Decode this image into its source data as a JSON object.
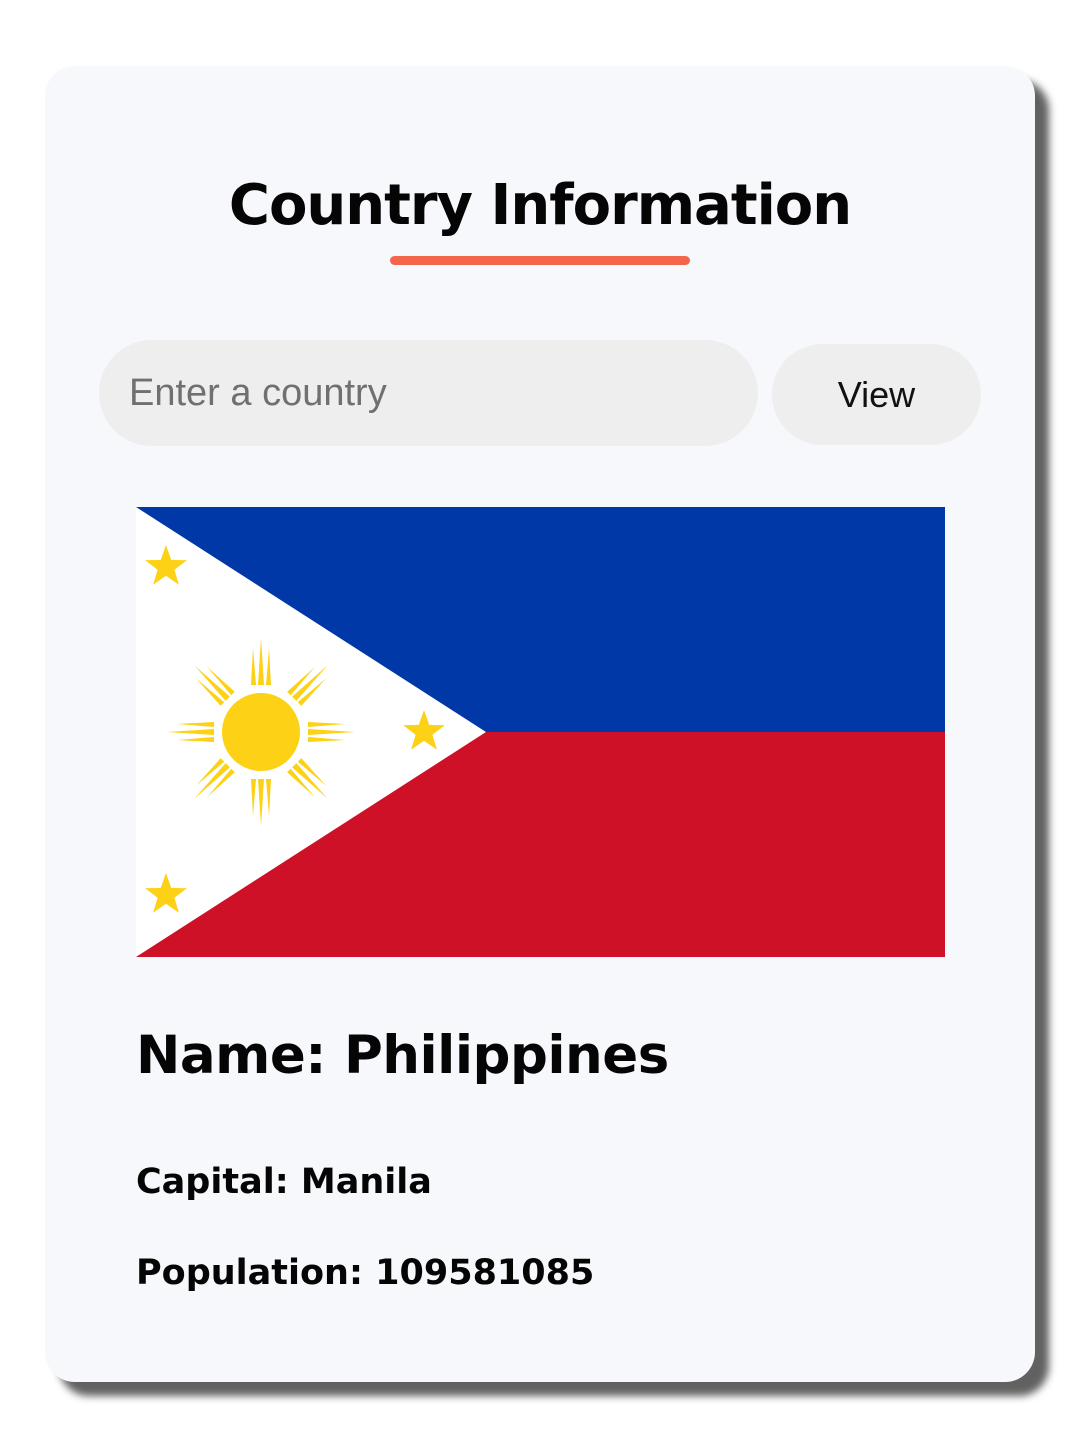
{
  "app": {
    "title": "Country Information",
    "accent_color": "#f4664c",
    "card_background": "#f7f8fc"
  },
  "search": {
    "placeholder": "Enter a country",
    "value": "",
    "button_label": "View"
  },
  "country": {
    "name_line": "Name: Philippines",
    "capital_line": "Capital: Manila",
    "population_line": "Population: 109581085",
    "flag": {
      "description_icon": "philippines-flag",
      "colors": {
        "blue": "#0038a8",
        "red": "#ce1126",
        "white": "#ffffff",
        "yellow": "#fcd116"
      }
    }
  }
}
